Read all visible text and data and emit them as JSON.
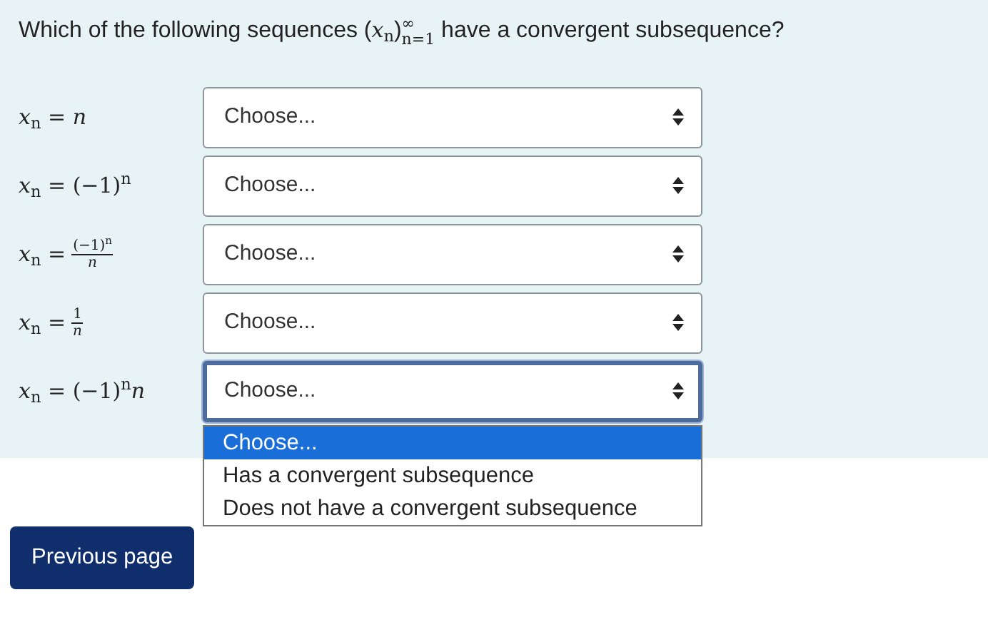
{
  "question": [
    {
      "kind": "text",
      "text": "Which of the following sequences ("
    },
    {
      "kind": "math",
      "text": "*x*$_{n}$"
    },
    {
      "kind": "text",
      "text": ")"
    },
    {
      "kind": "supsub",
      "sup": "∞",
      "sub": "n=1"
    },
    {
      "kind": "text",
      "text": " have a convergent subsequence?"
    }
  ],
  "rows": [
    {
      "formula": [
        {
          "kind": "math",
          "text": "*x*$_{n}$ = *n*"
        }
      ],
      "select": {
        "value": "Choose...",
        "focused": false
      }
    },
    {
      "formula": [
        {
          "kind": "math",
          "text": "*x*$_{n}$ = (−1)$^{n}$"
        }
      ],
      "select": {
        "value": "Choose...",
        "focused": false
      }
    },
    {
      "formula": [
        {
          "kind": "math",
          "text": "*x*$_{n}$ ="
        },
        {
          "kind": "fraction",
          "numerator": "(−1)$^{n}$",
          "denominator": "*n*"
        }
      ],
      "select": {
        "value": "Choose...",
        "focused": false
      }
    },
    {
      "formula": [
        {
          "kind": "math",
          "text": "*x*$_{n}$ ="
        },
        {
          "kind": "fraction",
          "numerator": "1",
          "denominator": "*n*"
        }
      ],
      "select": {
        "value": "Choose...",
        "focused": false
      }
    },
    {
      "formula": [
        {
          "kind": "math",
          "text": "*x*$_{n}$ = (−1)$^{n}$*n*"
        }
      ],
      "select": {
        "value": "Choose...",
        "focused": true,
        "options": [
          {
            "label": "Choose...",
            "selected": true
          },
          {
            "label": "Has a convergent subsequence",
            "selected": false
          },
          {
            "label": "Does not have a convergent subsequence",
            "selected": false
          }
        ]
      }
    }
  ],
  "previous_button": "Previous page"
}
